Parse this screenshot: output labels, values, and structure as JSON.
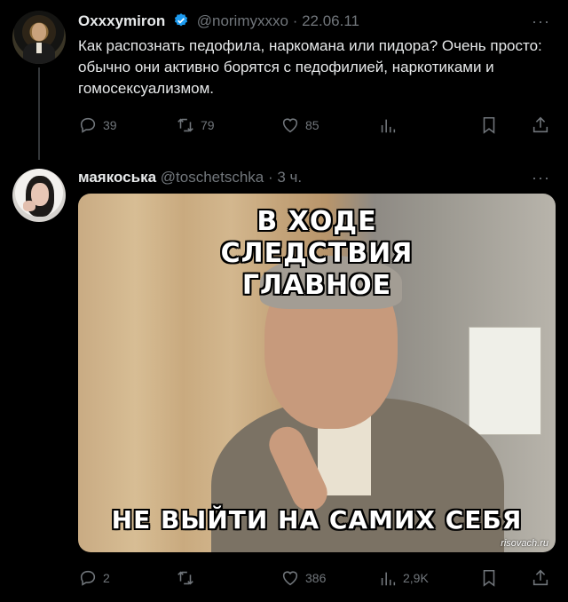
{
  "tweet1": {
    "name": "Oxxxymiron",
    "handle": "@norimyxxxo",
    "date": "· 22.06.11",
    "more": "···",
    "text": "Как распознать педофила, наркомана или пидора? Очень просто: обычно они активно борятся с педофилией, наркотиками и гомосексуализмом.",
    "replies": "39",
    "retweets": "79",
    "likes": "85",
    "views": ""
  },
  "tweet2": {
    "name": "маякоська",
    "handle": "@toschetschka",
    "date": "· 3 ч.",
    "more": "···",
    "meme_top": "В ХОДЕ СЛЕДСТВИЯ ГЛАВНОЕ",
    "meme_bottom": "НЕ ВЫЙТИ НА САМИХ СЕБЯ",
    "watermark": "risovach.ru",
    "replies": "2",
    "retweets": "",
    "likes": "386",
    "views": "2,9K"
  },
  "colors": {
    "background": "#000000",
    "text": "#e7e9ea",
    "muted": "#71767b",
    "verified": "#1d9bf0"
  },
  "icons": [
    "reply-icon",
    "retweet-icon",
    "like-icon",
    "views-icon",
    "bookmark-icon",
    "share-icon",
    "verified-icon"
  ]
}
